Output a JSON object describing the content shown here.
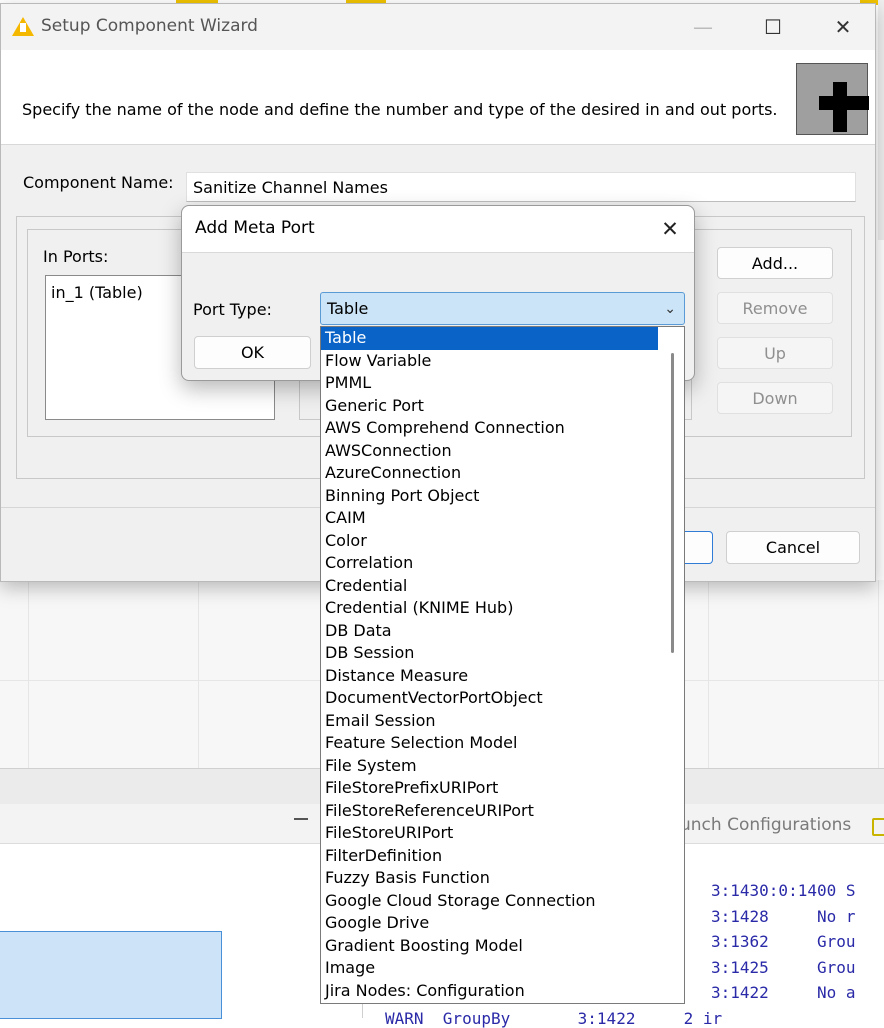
{
  "background": {
    "launch_tab": "unch Configurations",
    "console_lines": [
      "3:1430:0:1400 S",
      "3:1428     No r",
      "3:1362     Grou",
      "3:1425     Grou",
      "3:1422     No a",
      "WARN  GroupBy       3:1422     2 ir"
    ]
  },
  "wizard": {
    "title": "Setup Component Wizard",
    "minimize": "—",
    "maximize": "☐",
    "close": "✕",
    "description": "Specify the name of the node and define the number and type of the desired in and out ports.",
    "name_label": "Component Name:",
    "name_value": "Sanitize Channel Names",
    "in_ports_label": "In Ports:",
    "in_ports": [
      "in_1 (Table)"
    ],
    "buttons": {
      "add": "Add...",
      "remove": "Remove",
      "up": "Up",
      "down": "Down",
      "cancel": "Cancel"
    }
  },
  "meta_port": {
    "title": "Add Meta Port",
    "close": "✕",
    "port_type_label": "Port Type:",
    "selected": "Table",
    "ok": "OK",
    "arrow": "⌄"
  },
  "dropdown": {
    "selected_index": 0,
    "items": [
      "Table",
      "Flow Variable",
      "PMML",
      "Generic Port",
      "AWS Comprehend Connection",
      "AWSConnection",
      "AzureConnection",
      "Binning Port Object",
      "CAIM",
      "Color",
      "Correlation",
      "Credential",
      "Credential (KNIME Hub)",
      "DB Data",
      "DB Session",
      "Distance Measure",
      "DocumentVectorPortObject",
      "Email Session",
      "Feature Selection Model",
      "File System",
      "FileStorePrefixURIPort",
      "FileStoreReferenceURIPort",
      "FileStoreURIPort",
      "FilterDefinition",
      "Fuzzy Basis Function",
      "Google Cloud Storage Connection",
      "Google Drive",
      "Gradient Boosting Model",
      "Image",
      "Jira Nodes: Configuration"
    ]
  }
}
